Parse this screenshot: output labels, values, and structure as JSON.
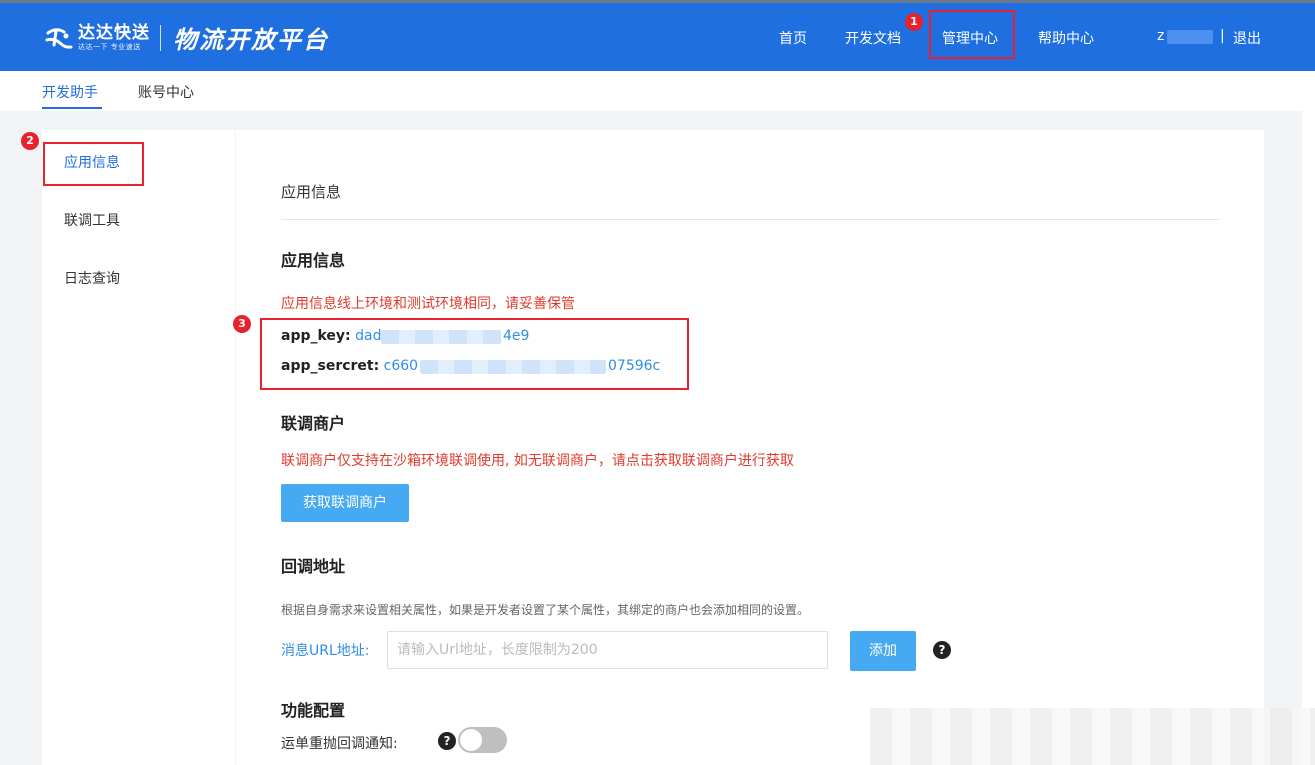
{
  "header": {
    "brand": "达达快送",
    "slogan": "达达一下 专业速送",
    "platform": "物流开放平台",
    "nav": {
      "home": "首页",
      "docs": "开发文档",
      "manage": "管理中心",
      "help": "帮助中心",
      "user": "z",
      "separator": "|",
      "logout": "退出"
    },
    "colors": {
      "bar": "#1f6fe0"
    }
  },
  "subnav": {
    "dev_assistant": "开发助手",
    "account_center": "账号中心"
  },
  "sidebar": {
    "items": [
      {
        "label": "应用信息"
      },
      {
        "label": "联调工具"
      },
      {
        "label": "日志查询"
      }
    ]
  },
  "main": {
    "panel_title": "应用信息",
    "app_info": {
      "title": "应用信息",
      "warning": "应用信息线上环境和测试环境相同，请妥善保管",
      "app_key_label": "app_key:",
      "app_key_start": "dadac",
      "app_key_end": "4e9",
      "app_secret_label": "app_sercret:",
      "app_secret_start": "c660",
      "app_secret_end": "07596c"
    },
    "debug_merchant": {
      "title": "联调商户",
      "warning": "联调商户仅支持在沙箱环境联调使用, 如无联调商户，请点击获取联调商户进行获取",
      "button": "获取联调商户"
    },
    "callback": {
      "title": "回调地址",
      "hint": "根据自身需求来设置相关属性，如果是开发者设置了某个属性，其绑定的商户也会添加相同的设置。",
      "url_label": "消息URL地址:",
      "url_placeholder": "请输入Url地址，长度限制为200",
      "add_button": "添加",
      "help_icon": "?"
    },
    "features": {
      "title": "功能配置",
      "resend_label": "运单重抛回调通知:",
      "help_icon": "?",
      "resend_enabled": false
    }
  },
  "annotations": [
    "1",
    "2",
    "3"
  ]
}
